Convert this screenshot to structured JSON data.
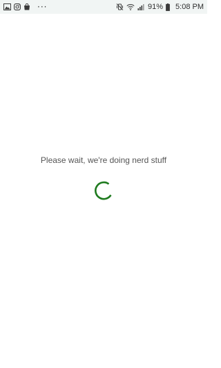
{
  "status_bar": {
    "left_icons": [
      "gallery-icon",
      "instagram-icon",
      "shopping-bag-icon"
    ],
    "more_indicator": "···",
    "right_icons": [
      "vibrate-mute-icon",
      "wifi-icon",
      "signal-icon",
      "battery-icon"
    ],
    "battery": "91%",
    "time": "5:08 PM"
  },
  "loading": {
    "message": "Please wait, we're doing nerd stuff",
    "spinner_color": "#1e7a1e"
  },
  "colors": {
    "status_bar_bg": "#f1f5f4",
    "background": "#ffffff",
    "text": "#555555"
  }
}
